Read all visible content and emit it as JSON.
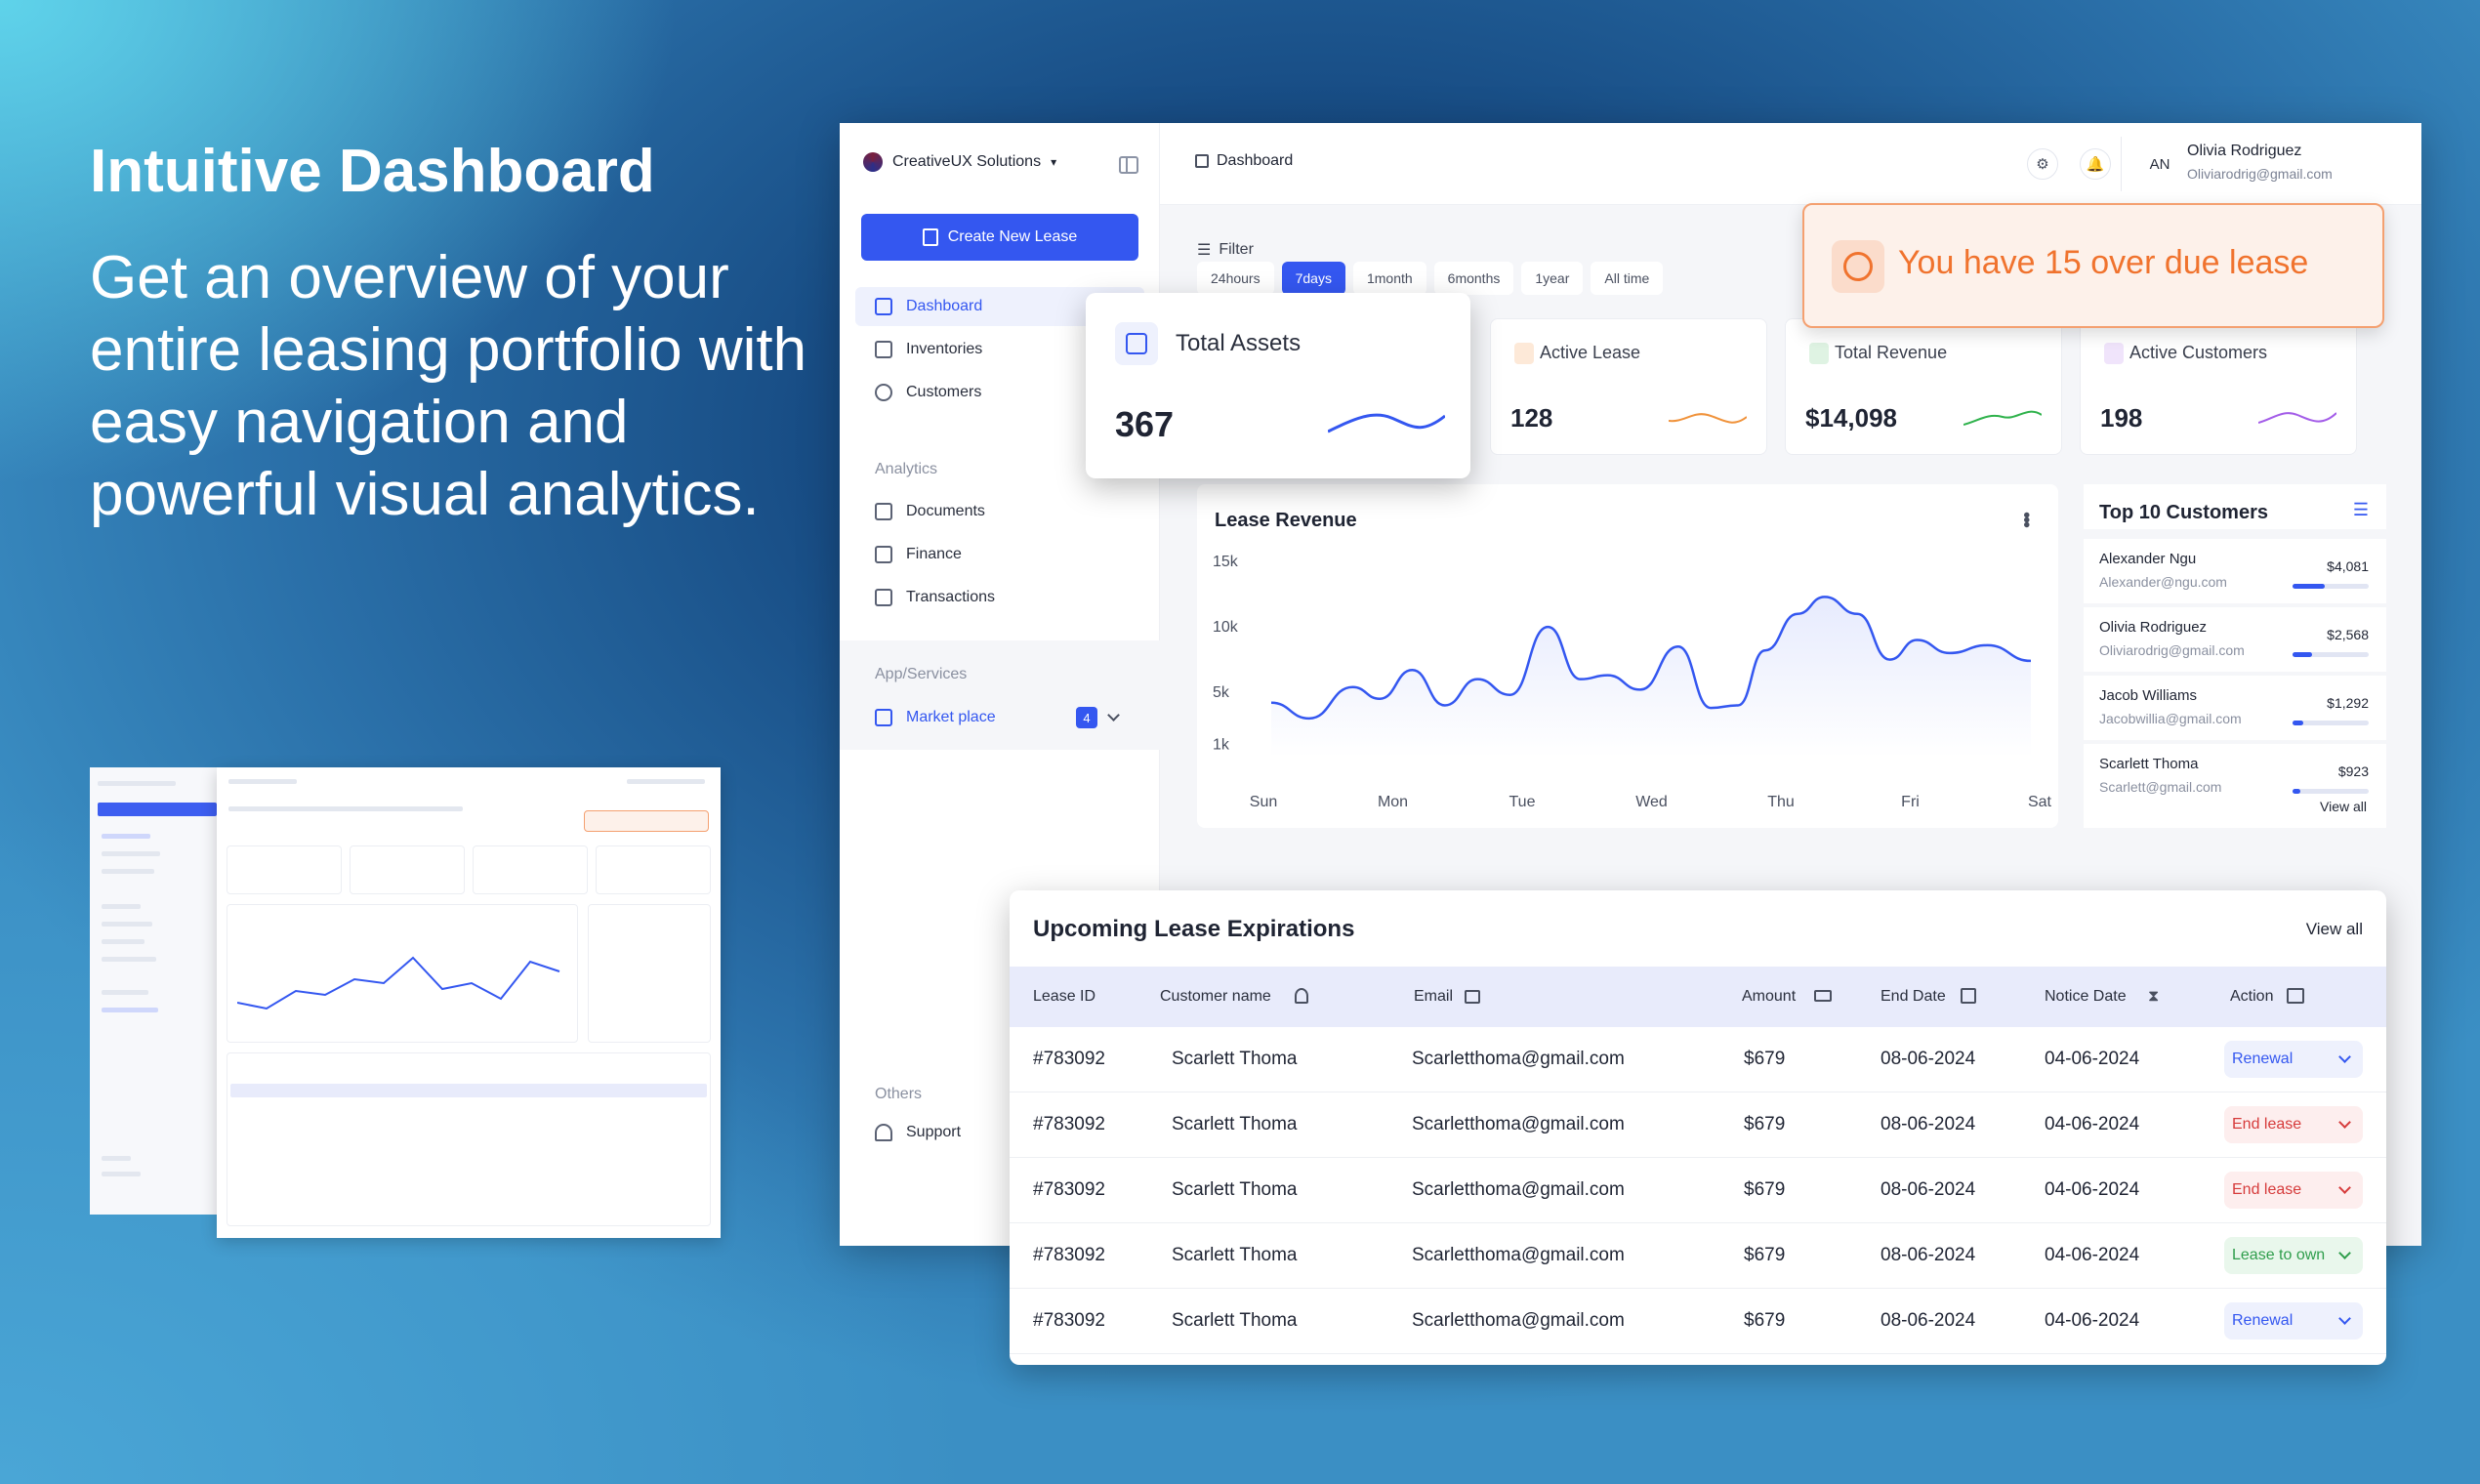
{
  "hero": {
    "title": "Intuitive Dashboard",
    "subtitle": "Get an overview of your entire leasing portfolio with easy navigation and powerful visual analytics."
  },
  "sidebar": {
    "company": "CreativeUX Solutions",
    "new_button": "Create New Lease",
    "items": [
      {
        "label": "Dashboard",
        "icon": "grid-icon"
      },
      {
        "label": "Inventories",
        "icon": "inventory-icon"
      },
      {
        "label": "Customers",
        "icon": "users-icon"
      }
    ],
    "analytics_label": "Analytics",
    "analytics_items": [
      {
        "label": "Documents",
        "icon": "briefcase-icon"
      },
      {
        "label": "Finance",
        "icon": "finance-icon"
      },
      {
        "label": "Transactions",
        "icon": "transactions-icon"
      }
    ],
    "apps_label": "App/Services",
    "market": {
      "label": "Market place",
      "badge": "4"
    },
    "others_label": "Others",
    "support": "Support"
  },
  "topbar": {
    "breadcrumb": "Dashboard",
    "avatar": "AN",
    "user_name": "Olivia Rodriguez",
    "user_email": "Oliviarodrig@gmail.com"
  },
  "filter": {
    "label": "Filter",
    "tabs": [
      "24hours",
      "7days",
      "1month",
      "6months",
      "1year",
      "All time"
    ],
    "selected": "7days"
  },
  "kpis": {
    "total_assets": {
      "title": "Total Assets",
      "value": "367"
    },
    "active_lease": {
      "title": "Active Lease",
      "value": "128"
    },
    "total_revenue": {
      "title": "Total Revenue",
      "value": "$14,098"
    },
    "active_customers": {
      "title": "Active Customers",
      "value": "198"
    }
  },
  "alert": {
    "text": "You have 15 over due lease"
  },
  "chart_data": {
    "type": "area",
    "title": "Lease Revenue",
    "categories": [
      "Sun",
      "Mon",
      "Tue",
      "Wed",
      "Thu",
      "Fri",
      "Sat"
    ],
    "y_ticks": [
      "15k",
      "10k",
      "5k",
      "1k"
    ],
    "x": [
      0,
      0.35,
      0.75,
      1.0,
      1.3,
      1.6,
      1.9,
      2.2,
      2.55,
      2.85,
      3.1,
      3.4,
      3.75,
      4.05,
      4.3,
      4.55,
      4.85,
      5.1,
      5.4,
      5.7,
      5.95,
      6.25,
      6.6,
      7.0
    ],
    "values": [
      4200,
      3000,
      5400,
      4500,
      6700,
      4000,
      6000,
      4800,
      10000,
      6000,
      6300,
      5200,
      8500,
      3800,
      4000,
      8200,
      11000,
      12300,
      11000,
      7500,
      9000,
      8000,
      8600,
      7400
    ],
    "ylim": [
      0,
      16000
    ],
    "colors": {
      "line": "#3457f0"
    }
  },
  "top_customers": {
    "title": "Top 10 Customers",
    "view_all": "View all",
    "items": [
      {
        "name": "Alexander Ngu",
        "email": "Alexander@ngu.com",
        "amount": "$4,081",
        "pct": 0.42
      },
      {
        "name": "Olivia Rodriguez",
        "email": "Oliviarodrig@gmail.com",
        "amount": "$2,568",
        "pct": 0.26
      },
      {
        "name": "Jacob Williams",
        "email": "Jacobwillia@gmail.com",
        "amount": "$1,292",
        "pct": 0.14
      },
      {
        "name": "Scarlett Thoma",
        "email": "Scarlett@gmail.com",
        "amount": "$923",
        "pct": 0.1
      }
    ]
  },
  "expirations": {
    "title": "Upcoming Lease Expirations",
    "view_all": "View all",
    "columns": [
      "Lease ID",
      "Customer name",
      "Email",
      "Amount",
      "End Date",
      "Notice Date",
      "Action"
    ],
    "rows": [
      {
        "id": "#783092",
        "name": "Scarlett Thoma",
        "email": "Scarletthoma@gmail.com",
        "amount": "$679",
        "end": "08-06-2024",
        "notice": "04-06-2024",
        "action": "Renewal",
        "tone": "blue"
      },
      {
        "id": "#783092",
        "name": "Scarlett Thoma",
        "email": "Scarletthoma@gmail.com",
        "amount": "$679",
        "end": "08-06-2024",
        "notice": "04-06-2024",
        "action": "End lease",
        "tone": "red"
      },
      {
        "id": "#783092",
        "name": "Scarlett Thoma",
        "email": "Scarletthoma@gmail.com",
        "amount": "$679",
        "end": "08-06-2024",
        "notice": "04-06-2024",
        "action": "End lease",
        "tone": "red"
      },
      {
        "id": "#783092",
        "name": "Scarlett Thoma",
        "email": "Scarletthoma@gmail.com",
        "amount": "$679",
        "end": "08-06-2024",
        "notice": "04-06-2024",
        "action": "Lease to own",
        "tone": "green"
      },
      {
        "id": "#783092",
        "name": "Scarlett Thoma",
        "email": "Scarletthoma@gmail.com",
        "amount": "$679",
        "end": "08-06-2024",
        "notice": "04-06-2024",
        "action": "Renewal",
        "tone": "blue"
      }
    ]
  }
}
